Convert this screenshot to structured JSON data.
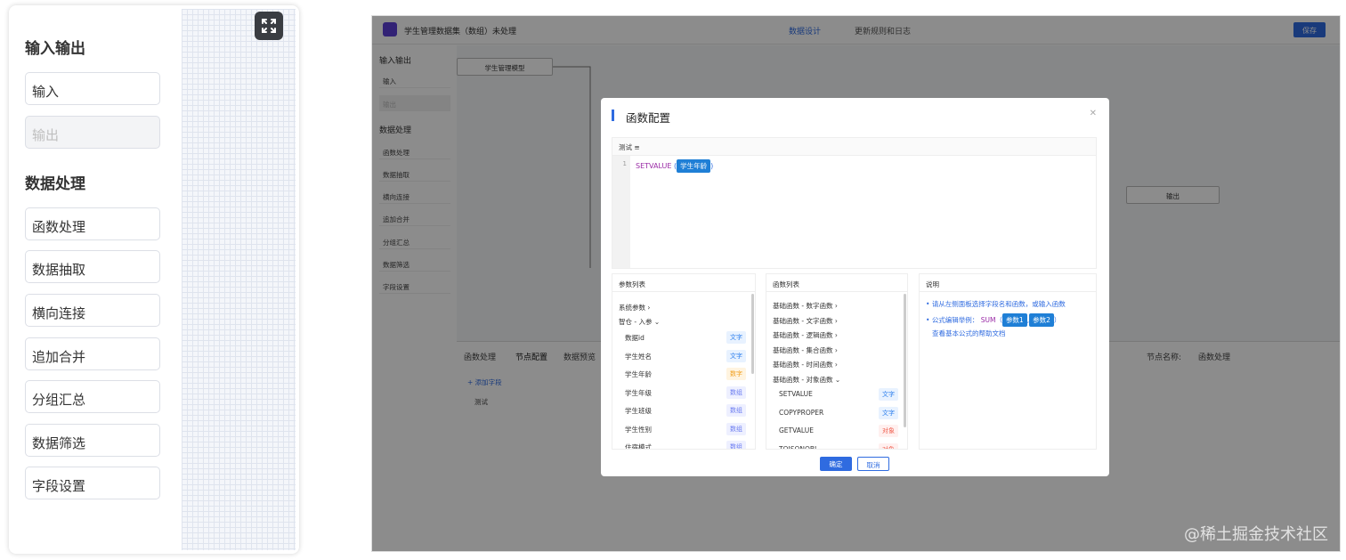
{
  "zoom": {
    "section_io": "输入输出",
    "btn_input": "输入",
    "btn_output": "输出",
    "section_proc": "数据处理",
    "items": [
      "函数处理",
      "数据抽取",
      "横向连接",
      "追加合并",
      "分组汇总",
      "数据筛选",
      "字段设置"
    ]
  },
  "app": {
    "title": "学生管理数据集（数组）未处理",
    "tab_design": "数据设计",
    "tab_rules": "更新规则和日志",
    "save": "保存",
    "side_io": "输入输出",
    "side_input": "输入",
    "side_output": "输出",
    "side_proc": "数据处理",
    "side_items": [
      "函数处理",
      "数据抽取",
      "横向连接",
      "追加合并",
      "分组汇总",
      "数据筛选",
      "字段设置"
    ],
    "node_model": "学生管理模型",
    "node_output": "输出",
    "bottom_tabs": [
      "函数处理",
      "节点配置",
      "数据预览"
    ],
    "add_field": "+ 添加字段",
    "test_row": "测试",
    "node_name_label": "节点名称:",
    "node_name_value": "函数处理"
  },
  "modal": {
    "title": "函数配置",
    "editor_header": "测试 ≡",
    "line_no": "1",
    "fn": "SETVALUE",
    "arg": "学生年龄",
    "params_title": "参数列表",
    "params_groups": [
      "系统参数",
      "智仓 - 入参"
    ],
    "params": [
      {
        "name": "数据id",
        "type": "文字",
        "kind": "text"
      },
      {
        "name": "学生姓名",
        "type": "文字",
        "kind": "text"
      },
      {
        "name": "学生年龄",
        "type": "数字",
        "kind": "num"
      },
      {
        "name": "学生年级",
        "type": "数组",
        "kind": "arr"
      },
      {
        "name": "学生班级",
        "type": "数组",
        "kind": "arr"
      },
      {
        "name": "学生性别",
        "type": "数组",
        "kind": "arr"
      },
      {
        "name": "住宿模式",
        "type": "数组",
        "kind": "arr"
      }
    ],
    "funcs_title": "函数列表",
    "func_groups": [
      "基础函数 - 数字函数",
      "基础函数 - 文字函数",
      "基础函数 - 逻辑函数",
      "基础函数 - 集合函数",
      "基础函数 - 时间函数",
      "基础函数 - 对象函数"
    ],
    "funcs": [
      {
        "name": "SETVALUE",
        "type": "文字",
        "kind": "text"
      },
      {
        "name": "COPYPROPER",
        "type": "文字",
        "kind": "text"
      },
      {
        "name": "GETVALUE",
        "type": "对象",
        "kind": "obj"
      },
      {
        "name": "TOJSONOBJ",
        "type": "对象",
        "kind": "obj"
      }
    ],
    "desc_title": "说明",
    "desc_line1": "请从左侧面板选择字段名和函数，或输入函数",
    "desc_line2_prefix": "公式编辑举例：",
    "desc_example_fn": "SUM",
    "desc_example_arg1": "参数1",
    "desc_example_arg2": "参数2",
    "desc_link": "查看基本公式的帮助文档",
    "ok": "确定",
    "cancel": "取消"
  },
  "watermark": "@稀土掘金技术社区"
}
